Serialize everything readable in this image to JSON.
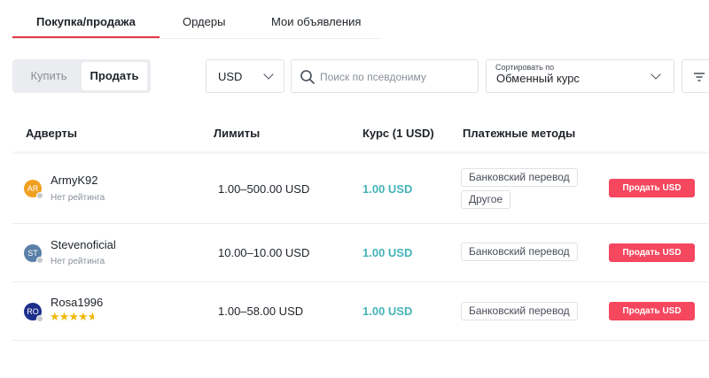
{
  "tabs": [
    {
      "label": "Покупка/продажа",
      "active": true
    },
    {
      "label": "Ордеры",
      "active": false
    },
    {
      "label": "Мои объявления",
      "active": false
    }
  ],
  "toggle": {
    "buy_label": "Купить",
    "sell_label": "Продать",
    "selected": "Продать"
  },
  "filters": {
    "currency": "USD",
    "search_placeholder": "Поиск по псевдониму",
    "search_value": "",
    "sort_label": "Сортировать по",
    "sort_value": "Обменный курс"
  },
  "table": {
    "headers": {
      "advertiser": "Адверты",
      "limits": "Лимиты",
      "rate": "Курс (1 USD)",
      "payment": "Платежные методы"
    },
    "rows": [
      {
        "avatar": "AR",
        "avatar_color": "#f0a020",
        "nick": "ArmyK92",
        "rating": "Нет рейтинга",
        "stars": null,
        "limits": "1.00–500.00 USD",
        "rate": "1.00 USD",
        "methods": [
          "Банковский перевод",
          "Другое"
        ],
        "button": "Продать USD"
      },
      {
        "avatar": "ST",
        "avatar_color": "#5a7fa8",
        "nick": "Stevenoficial",
        "rating": "Нет рейтинга",
        "stars": null,
        "limits": "10.00–10.00 USD",
        "rate": "1.00 USD",
        "methods": [
          "Банковский перевод"
        ],
        "button": "Продать USD"
      },
      {
        "avatar": "RO",
        "avatar_color": "#1d2f8c",
        "nick": "Rosa1996",
        "rating": "",
        "stars": 4.5,
        "limits": "1.00–58.00 USD",
        "rate": "1.00 USD",
        "methods": [
          "Банковский перевод"
        ],
        "button": "Продать USD"
      }
    ]
  },
  "colors": {
    "accent_red": "#e8364a",
    "sell_button": "#f5475e",
    "rate_teal": "#45b4b9",
    "star": "#f0b90b"
  },
  "icons": {
    "search": "search-icon",
    "dropdown": "chevron-down-icon",
    "filter": "filter-icon",
    "status": "status-dot-icon",
    "star": "star-icon"
  }
}
